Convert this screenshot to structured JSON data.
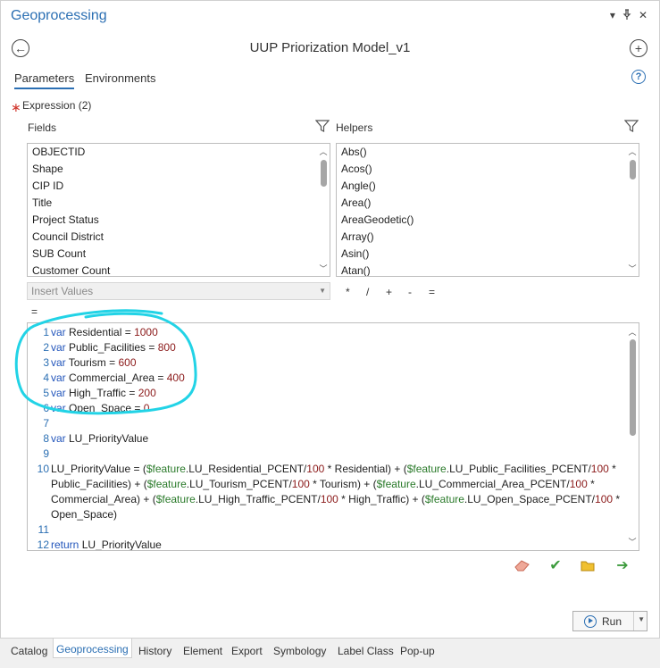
{
  "pane": {
    "title": "Geoprocessing",
    "window_controls": [
      "▾",
      "📌",
      "✕"
    ],
    "tool_title": "UUP Priorization Model_v1"
  },
  "tabs": [
    {
      "label": "Parameters",
      "active": true
    },
    {
      "label": "Environments",
      "active": false
    }
  ],
  "param": {
    "required_marker": "∗",
    "label": "Expression (2)"
  },
  "fields": {
    "header": "Fields",
    "items": [
      "OBJECTID",
      "Shape",
      "CIP ID",
      "Title",
      "Project Status",
      "Council District",
      "SUB Count",
      "Customer Count"
    ]
  },
  "helpers": {
    "header": "Helpers",
    "items": [
      "Abs()",
      "Acos()",
      "Angle()",
      "Area()",
      "AreaGeodetic()",
      "Array()",
      "Asin()",
      "Atan()"
    ]
  },
  "insert_values": {
    "placeholder": "Insert Values"
  },
  "operators": [
    "*",
    "/",
    "+",
    "-",
    "=",
    "="
  ],
  "code": [
    {
      "n": "1",
      "parts": [
        [
          "kw",
          "var"
        ],
        [
          "t",
          " Residential = "
        ],
        [
          "num",
          "1000"
        ]
      ]
    },
    {
      "n": "2",
      "parts": [
        [
          "kw",
          "var"
        ],
        [
          "t",
          " Public_Facilities = "
        ],
        [
          "num",
          "800"
        ]
      ]
    },
    {
      "n": "3",
      "parts": [
        [
          "kw",
          "var"
        ],
        [
          "t",
          " Tourism = "
        ],
        [
          "num",
          "600"
        ]
      ]
    },
    {
      "n": "4",
      "parts": [
        [
          "kw",
          "var"
        ],
        [
          "t",
          " Commercial_Area = "
        ],
        [
          "num",
          "400"
        ]
      ]
    },
    {
      "n": "5",
      "parts": [
        [
          "kw",
          "var"
        ],
        [
          "t",
          " High_Traffic = "
        ],
        [
          "num",
          "200"
        ]
      ]
    },
    {
      "n": "6",
      "parts": [
        [
          "kw",
          "var"
        ],
        [
          "t",
          " Open_Space = "
        ],
        [
          "num",
          "0"
        ]
      ]
    },
    {
      "n": "7",
      "parts": []
    },
    {
      "n": "8",
      "parts": [
        [
          "kw",
          "var"
        ],
        [
          "t",
          " LU_PriorityValue"
        ]
      ]
    },
    {
      "n": "9",
      "parts": []
    },
    {
      "n": "10",
      "parts": [
        [
          "t",
          "LU_PriorityValue = ("
        ],
        [
          "feat",
          "$feature"
        ],
        [
          "t",
          ".LU_Residential_PCENT/"
        ],
        [
          "num",
          "100"
        ],
        [
          "t",
          " * Residential) + ("
        ],
        [
          "feat",
          "$feature"
        ],
        [
          "t",
          ".LU_Public_Facilities_PCENT/"
        ],
        [
          "num",
          "100"
        ],
        [
          "t",
          " *"
        ]
      ]
    },
    {
      "n": "",
      "parts": [
        [
          "t",
          "Public_Facilities) + ("
        ],
        [
          "feat",
          "$feature"
        ],
        [
          "t",
          ".LU_Tourism_PCENT/"
        ],
        [
          "num",
          "100"
        ],
        [
          "t",
          " * Tourism) + ("
        ],
        [
          "feat",
          "$feature"
        ],
        [
          "t",
          ".LU_Commercial_Area_PCENT/"
        ],
        [
          "num",
          "100"
        ],
        [
          "t",
          " *"
        ]
      ]
    },
    {
      "n": "",
      "parts": [
        [
          "t",
          "Commercial_Area) + ("
        ],
        [
          "feat",
          "$feature"
        ],
        [
          "t",
          ".LU_High_Traffic_PCENT/"
        ],
        [
          "num",
          "100"
        ],
        [
          "t",
          " * High_Traffic) + ("
        ],
        [
          "feat",
          "$feature"
        ],
        [
          "t",
          ".LU_Open_Space_PCENT/"
        ],
        [
          "num",
          "100"
        ],
        [
          "t",
          " *"
        ]
      ]
    },
    {
      "n": "",
      "parts": [
        [
          "t",
          "Open_Space)"
        ]
      ]
    },
    {
      "n": "11",
      "parts": []
    },
    {
      "n": "12",
      "parts": [
        [
          "kw",
          "return"
        ],
        [
          "t",
          " LU_PriorityValue"
        ]
      ]
    }
  ],
  "actions": [
    {
      "name": "eraser-icon",
      "glyph": "▰",
      "color": "#e8907a"
    },
    {
      "name": "verify-check-icon",
      "glyph": "✔",
      "color": "#3d9b3d"
    },
    {
      "name": "open-folder-icon",
      "glyph": "🗁",
      "color": "#d9a520"
    },
    {
      "name": "save-arrow-icon",
      "glyph": "➔",
      "color": "#3d9b3d"
    }
  ],
  "run": {
    "label": "Run"
  },
  "bottom_tabs": [
    {
      "label": "Catalog",
      "active": false
    },
    {
      "label": "Geoprocessing",
      "active": true
    },
    {
      "label": "History",
      "active": false
    },
    {
      "label": "Element",
      "active": false
    },
    {
      "label": "Export",
      "active": false
    },
    {
      "label": "Symbology",
      "active": false
    },
    {
      "label": "Label Class",
      "active": false
    },
    {
      "label": "Pop-up",
      "active": false
    }
  ],
  "colors": {
    "accent": "#2b6fb3",
    "annotation": "#22d3e6"
  }
}
